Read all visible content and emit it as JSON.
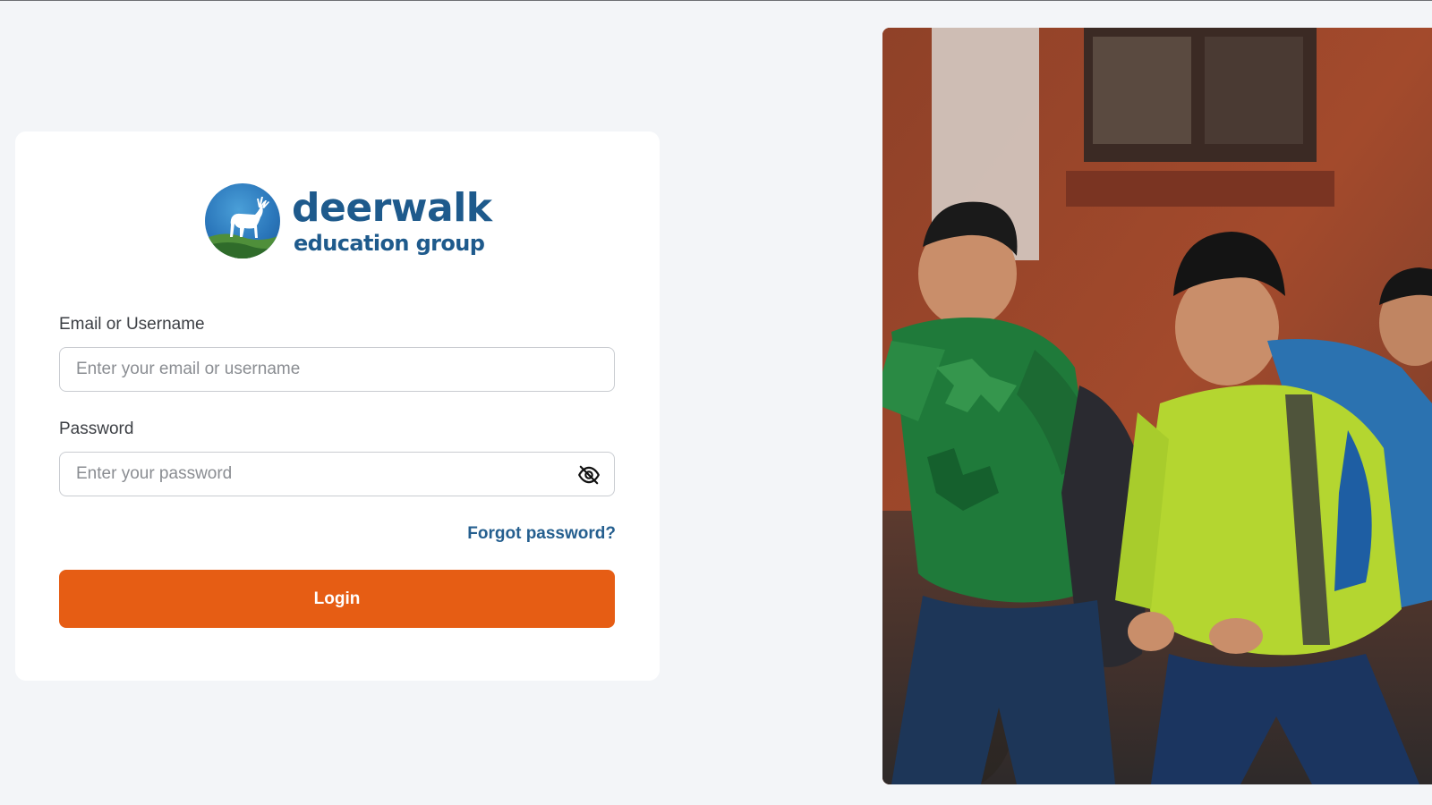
{
  "brand": {
    "name": "deerwalk",
    "tagline": "education group"
  },
  "form": {
    "email_label": "Email or Username",
    "email_placeholder": "Enter your email or username",
    "email_value": "",
    "password_label": "Password",
    "password_placeholder": "Enter your password",
    "password_value": "",
    "password_toggle_icon": "eye-off-icon",
    "forgot_password": "Forgot password?",
    "login_button": "Login"
  },
  "colors": {
    "background": "#f3f5f8",
    "card": "#ffffff",
    "brand_blue": "#1e5a8c",
    "link": "#255f8f",
    "accent": "#e65d14"
  }
}
